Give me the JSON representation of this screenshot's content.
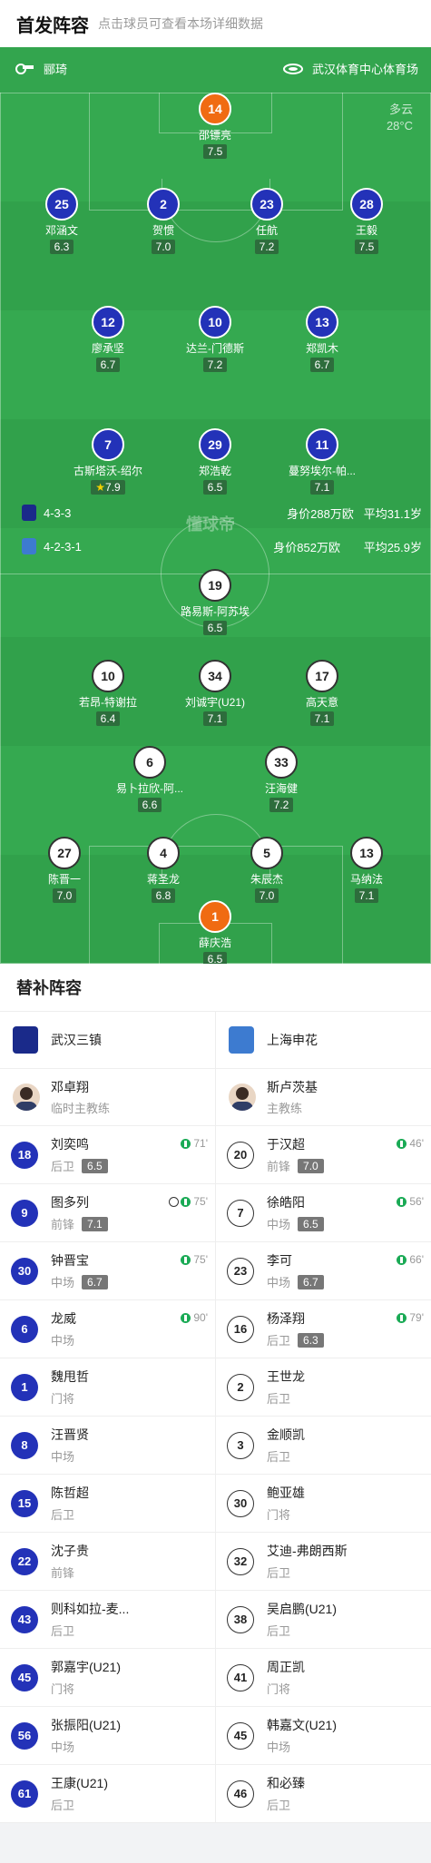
{
  "header": {
    "title": "首发阵容",
    "subtitle": "点击球员可查看本场详细数据"
  },
  "pitch_top": {
    "referee": "郦琦",
    "stadium": "武汉体育中心体育场"
  },
  "weather": {
    "condition": "多云",
    "temp": "28°C"
  },
  "teams": {
    "home": {
      "formation": "4-3-3",
      "value": "身价288万欧",
      "age": "平均31.1岁"
    },
    "away": {
      "formation": "4-2-3-1",
      "value": "身价852万欧",
      "age": "平均25.9岁"
    }
  },
  "watermark": "懂球帝",
  "home_players": [
    {
      "num": "14",
      "name": "邵镖亮",
      "rating": "7.5",
      "gk": true
    },
    {
      "num": "25",
      "name": "邓涵文",
      "rating": "6.3",
      "yellow": true
    },
    {
      "num": "2",
      "name": "贺惯",
      "rating": "7.0",
      "sub": "71'"
    },
    {
      "num": "23",
      "name": "任航",
      "rating": "7.2",
      "captain": true
    },
    {
      "num": "28",
      "name": "王毅",
      "rating": "7.5"
    },
    {
      "num": "12",
      "name": "廖承坚",
      "rating": "6.7",
      "yellow": true,
      "sub": "75'"
    },
    {
      "num": "10",
      "name": "达兰-门德斯",
      "rating": "7.2",
      "sub": "90'"
    },
    {
      "num": "13",
      "name": "郑凯木",
      "rating": "6.7"
    },
    {
      "num": "7",
      "name": "古斯塔沃-绍尔",
      "rating": "7.9",
      "star": true
    },
    {
      "num": "29",
      "name": "郑浩乾",
      "rating": "6.5",
      "sub": "75'"
    },
    {
      "num": "11",
      "name": "蔓努埃尔-帕...",
      "rating": "7.1"
    }
  ],
  "away_players": [
    {
      "num": "19",
      "name": "路易斯-阿苏埃",
      "rating": "6.5",
      "yellow": true
    },
    {
      "num": "10",
      "name": "若昂-特谢拉",
      "rating": "6.4",
      "yellow": true
    },
    {
      "num": "34",
      "name": "刘诚宇(U21)",
      "rating": "7.1",
      "sub": "66'"
    },
    {
      "num": "17",
      "name": "高天意",
      "rating": "7.1",
      "yellow": true,
      "sub": "56'"
    },
    {
      "num": "6",
      "name": "易卜拉欣-阿...",
      "rating": "6.6",
      "sub": "46'"
    },
    {
      "num": "33",
      "name": "汪海健",
      "rating": "7.2",
      "sub": "79'"
    },
    {
      "num": "27",
      "name": "陈晋一",
      "rating": "7.0"
    },
    {
      "num": "4",
      "name": "蒋圣龙",
      "rating": "6.8"
    },
    {
      "num": "5",
      "name": "朱辰杰",
      "rating": "7.0",
      "captain": true
    },
    {
      "num": "13",
      "name": "马纳法",
      "rating": "7.1"
    },
    {
      "num": "1",
      "name": "薛庆浩",
      "rating": "6.5",
      "gk": true
    }
  ],
  "subs_section": {
    "title": "替补阵容",
    "home": {
      "team": "武汉三镇",
      "coach": {
        "name": "邓卓翔",
        "role": "临时主教练"
      },
      "players": [
        {
          "num": "18",
          "name": "刘奕鸣",
          "pos": "后卫",
          "rating": "6.5",
          "in": "71'"
        },
        {
          "num": "9",
          "name": "图多列",
          "pos": "前锋",
          "rating": "7.1",
          "in": "75'",
          "goal": true
        },
        {
          "num": "30",
          "name": "钟晋宝",
          "pos": "中场",
          "rating": "6.7",
          "in": "75'"
        },
        {
          "num": "6",
          "name": "龙威",
          "pos": "中场",
          "in": "90'"
        },
        {
          "num": "1",
          "name": "魏甩哲",
          "pos": "门将"
        },
        {
          "num": "8",
          "name": "汪晋贤",
          "pos": "中场"
        },
        {
          "num": "15",
          "name": "陈哲超",
          "pos": "后卫"
        },
        {
          "num": "22",
          "name": "沈子贵",
          "pos": "前锋"
        },
        {
          "num": "43",
          "name": "则科如拉-麦...",
          "pos": "后卫"
        },
        {
          "num": "45",
          "name": "郭嘉宇(U21)",
          "pos": "门将"
        },
        {
          "num": "56",
          "name": "张振阳(U21)",
          "pos": "中场"
        },
        {
          "num": "61",
          "name": "王康(U21)",
          "pos": "后卫"
        }
      ]
    },
    "away": {
      "team": "上海申花",
      "coach": {
        "name": "斯卢茨基",
        "role": "主教练"
      },
      "players": [
        {
          "num": "20",
          "name": "于汉超",
          "pos": "前锋",
          "rating": "7.0",
          "in": "46'"
        },
        {
          "num": "7",
          "name": "徐皓阳",
          "pos": "中场",
          "rating": "6.5",
          "in": "56'"
        },
        {
          "num": "23",
          "name": "李可",
          "pos": "中场",
          "rating": "6.7",
          "in": "66'"
        },
        {
          "num": "16",
          "name": "杨泽翔",
          "pos": "后卫",
          "rating": "6.3",
          "in": "79'"
        },
        {
          "num": "2",
          "name": "王世龙",
          "pos": "后卫"
        },
        {
          "num": "3",
          "name": "金顺凯",
          "pos": "后卫"
        },
        {
          "num": "30",
          "name": "鲍亚雄",
          "pos": "门将"
        },
        {
          "num": "32",
          "name": "艾迪-弗朗西斯",
          "pos": "后卫"
        },
        {
          "num": "38",
          "name": "吴启鹏(U21)",
          "pos": "后卫"
        },
        {
          "num": "41",
          "name": "周正凯",
          "pos": "门将"
        },
        {
          "num": "45",
          "name": "韩嘉文(U21)",
          "pos": "中场"
        },
        {
          "num": "46",
          "name": "和必臻",
          "pos": "后卫"
        }
      ]
    }
  }
}
